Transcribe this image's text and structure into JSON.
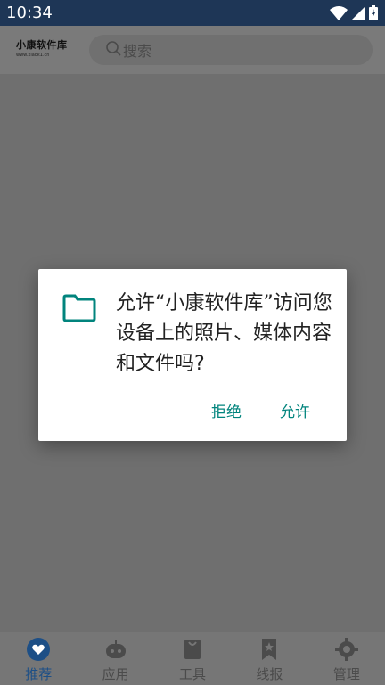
{
  "status": {
    "time": "10:34",
    "icons": [
      "wifi-icon",
      "signal-icon",
      "battery-icon"
    ]
  },
  "header": {
    "logo_text": "小康软件库",
    "logo_sub": "www.xiaok1.cn",
    "search_placeholder": "搜索"
  },
  "dialog": {
    "message": "允许“小康软件库”访问您设备上的照片、媒体内容和文件吗?",
    "deny_label": "拒绝",
    "allow_label": "允许",
    "icon": "folder-icon"
  },
  "nav": {
    "items": [
      {
        "label": "推荐",
        "icon": "heart-icon",
        "active": true
      },
      {
        "label": "应用",
        "icon": "robot-icon",
        "active": false
      },
      {
        "label": "工具",
        "icon": "bag-icon",
        "active": false
      },
      {
        "label": "线报",
        "icon": "bookmark-star-icon",
        "active": false
      },
      {
        "label": "管理",
        "icon": "gear-icon",
        "active": false
      }
    ]
  },
  "colors": {
    "status_bar": "#1e3656",
    "accent": "#01847d",
    "nav_active": "#1d4f86"
  }
}
